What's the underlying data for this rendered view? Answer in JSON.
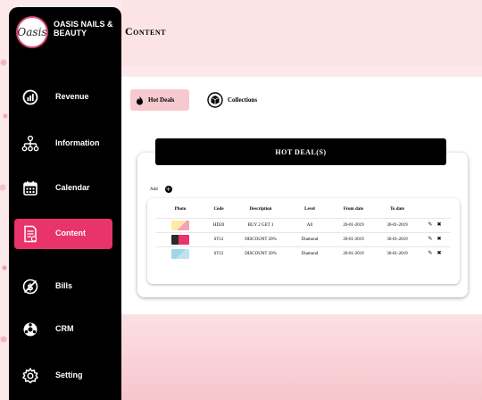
{
  "brand": {
    "logo_text": "Oasis",
    "name": "OASIS NAILS & BEAUTY"
  },
  "sidebar": {
    "items": [
      {
        "label": "Revenue",
        "icon": "chart-icon"
      },
      {
        "label": "Information",
        "icon": "org-chart-icon"
      },
      {
        "label": "Calendar",
        "icon": "calendar-icon"
      },
      {
        "label": "Content",
        "icon": "document-icon",
        "active": true
      },
      {
        "label": "Bills",
        "icon": "no-money-icon"
      },
      {
        "label": "CRM",
        "icon": "crm-icon"
      },
      {
        "label": "Setting",
        "icon": "gear-icon"
      }
    ]
  },
  "header": {
    "title": "Content"
  },
  "tabs": [
    {
      "label": "Hot Deals",
      "icon": "fire-icon",
      "active": true
    },
    {
      "label": "Collections",
      "icon": "box-icon",
      "active": false
    }
  ],
  "deals": {
    "banner": "HOT DEAL(S)",
    "add_label": "Add",
    "columns": [
      "Photo",
      "Code",
      "Description",
      "Level",
      "From date",
      "To date",
      ""
    ],
    "rows": [
      {
        "code": "HD20",
        "description": "BUY 2 GET 1",
        "level": "All",
        "from": "20-01-2019",
        "to": "30-01-2019"
      },
      {
        "code": "ST12",
        "description": "DISCOUNT 20%",
        "level": "Diamond",
        "from": "20-01-2019",
        "to": "30-01-2019"
      },
      {
        "code": "ST12",
        "description": "DISCOUNT 20%",
        "level": "Diamond",
        "from": "20-01-2019",
        "to": "30-01-2019"
      }
    ]
  },
  "colors": {
    "accent": "#e8336b",
    "sidebar_bg": "#000000",
    "tab_active_bg": "#f6c9cf",
    "header_bg": "#fbe3e6"
  }
}
